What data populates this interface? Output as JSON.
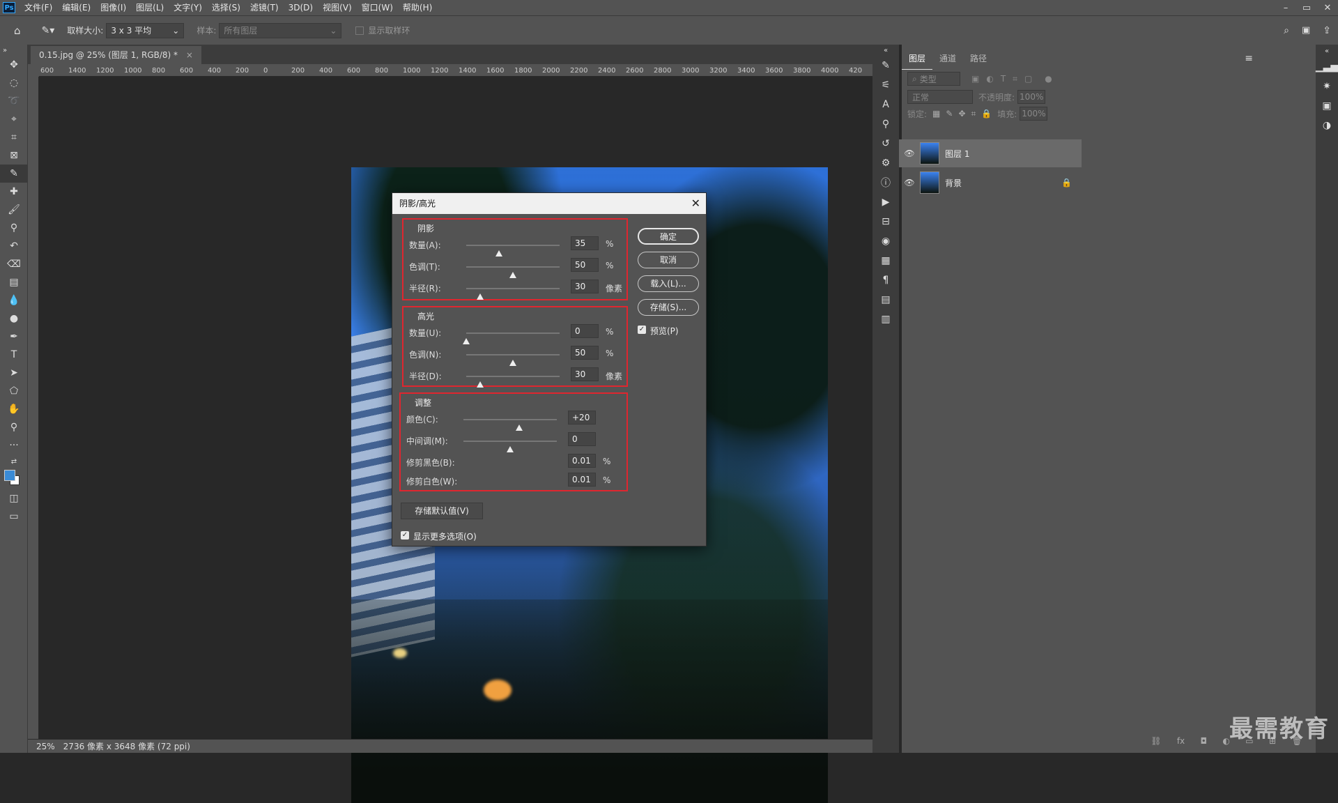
{
  "menubar": {
    "logo": "Ps",
    "items": [
      "文件(F)",
      "编辑(E)",
      "图像(I)",
      "图层(L)",
      "文字(Y)",
      "选择(S)",
      "滤镜(T)",
      "3D(D)",
      "视图(V)",
      "窗口(W)",
      "帮助(H)"
    ],
    "win_min": "–",
    "win_restore": "▭",
    "win_close": "✕"
  },
  "options": {
    "sample_size_label": "取样大小:",
    "sample_size_value": "3 x 3 平均",
    "sample_label": "样本:",
    "sample_value": "所有图层",
    "show_ring_label": "显示取样环"
  },
  "document": {
    "tab_title": "0.15.jpg @ 25% (图层 1, RGB/8) *",
    "tab_close": "×",
    "ruler_ticks": [
      "600",
      "1400",
      "1200",
      "1000",
      "800",
      "600",
      "400",
      "200",
      "0",
      "200",
      "400",
      "600",
      "800",
      "1000",
      "1200",
      "1400",
      "1600",
      "1800",
      "2000",
      "2200",
      "2400",
      "2600",
      "2800",
      "3000",
      "3200",
      "3400",
      "3600",
      "3800",
      "4000",
      "420"
    ]
  },
  "status": {
    "zoom": "25%",
    "info": "2736 像素 x 3648 像素 (72 ppi)"
  },
  "dialog": {
    "title": "阴影/高光",
    "close": "✕",
    "shadows": {
      "title": "阴影",
      "rows": [
        {
          "label": "数量(A):",
          "value": "35",
          "unit": "%",
          "pos": 0.35
        },
        {
          "label": "色调(T):",
          "value": "50",
          "unit": "%",
          "pos": 0.5
        },
        {
          "label": "半径(R):",
          "value": "30",
          "unit": "像素",
          "pos": 0.15
        }
      ]
    },
    "highlights": {
      "title": "高光",
      "rows": [
        {
          "label": "数量(U):",
          "value": "0",
          "unit": "%",
          "pos": 0.0
        },
        {
          "label": "色调(N):",
          "value": "50",
          "unit": "%",
          "pos": 0.5
        },
        {
          "label": "半径(D):",
          "value": "30",
          "unit": "像素",
          "pos": 0.15
        }
      ]
    },
    "adjust": {
      "title": "调整",
      "rows": [
        {
          "label": "颜色(C):",
          "value": "+20",
          "unit": "",
          "pos": 0.6
        },
        {
          "label": "中间调(M):",
          "value": "0",
          "unit": "",
          "pos": 0.5
        },
        {
          "label": "修剪黑色(B):",
          "value": "0.01",
          "unit": "%"
        },
        {
          "label": "修剪白色(W):",
          "value": "0.01",
          "unit": "%"
        }
      ]
    },
    "buttons": {
      "ok": "确定",
      "cancel": "取消",
      "load": "载入(L)...",
      "save": "存储(S)..."
    },
    "preview_label": "预览(P)",
    "save_default": "存储默认值(V)",
    "more_options_label": "显示更多选项(O)"
  },
  "layers_panel": {
    "tabs": [
      "图层",
      "通道",
      "路径"
    ],
    "filter_placeholder": "类型",
    "blend_mode": "正常",
    "opacity_label": "不透明度:",
    "opacity_value": "100%",
    "lock_label": "锁定:",
    "fill_label": "填充:",
    "fill_value": "100%",
    "layers": [
      {
        "name": "图层 1",
        "selected": true
      },
      {
        "name": "背景",
        "locked": true
      }
    ]
  },
  "watermark": "最需教育"
}
